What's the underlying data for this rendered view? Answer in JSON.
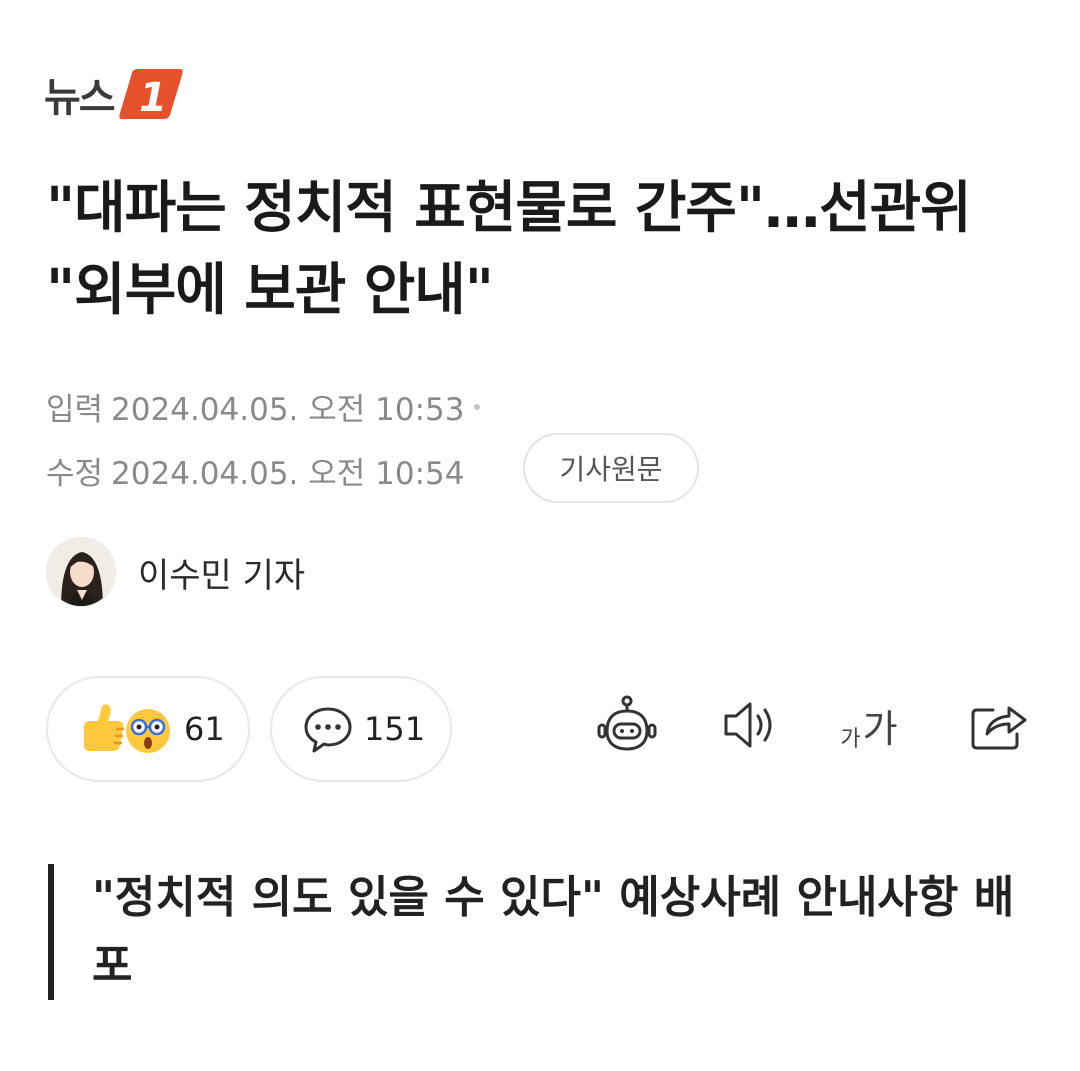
{
  "publisher": {
    "name": "뉴스1",
    "logo_text": "뉴스",
    "logo_badge": "1",
    "brand_color": "#E5512B"
  },
  "article": {
    "title": "\"대파는 정치적 표현물로 간주\"…선관위 \"외부에 보관 안내\"",
    "published_label": "입력",
    "published_at": "2024.04.05. 오전 10:53",
    "modified_label": "수정",
    "modified_at": "2024.04.05. 오전 10:54",
    "source_button": "기사원문",
    "author": "이수민 기자",
    "subheadline": "\"정치적 의도 있을 수 있다\" 예상사례 안내사항 배포"
  },
  "actions": {
    "reaction_count": "61",
    "comment_count": "151",
    "font_small": "가",
    "font_big": "가"
  },
  "icons": [
    "thumbs-up-emoji-icon",
    "surprised-emoji-icon",
    "comment-icon",
    "robot-icon",
    "speaker-icon",
    "font-size-icon",
    "share-icon"
  ]
}
